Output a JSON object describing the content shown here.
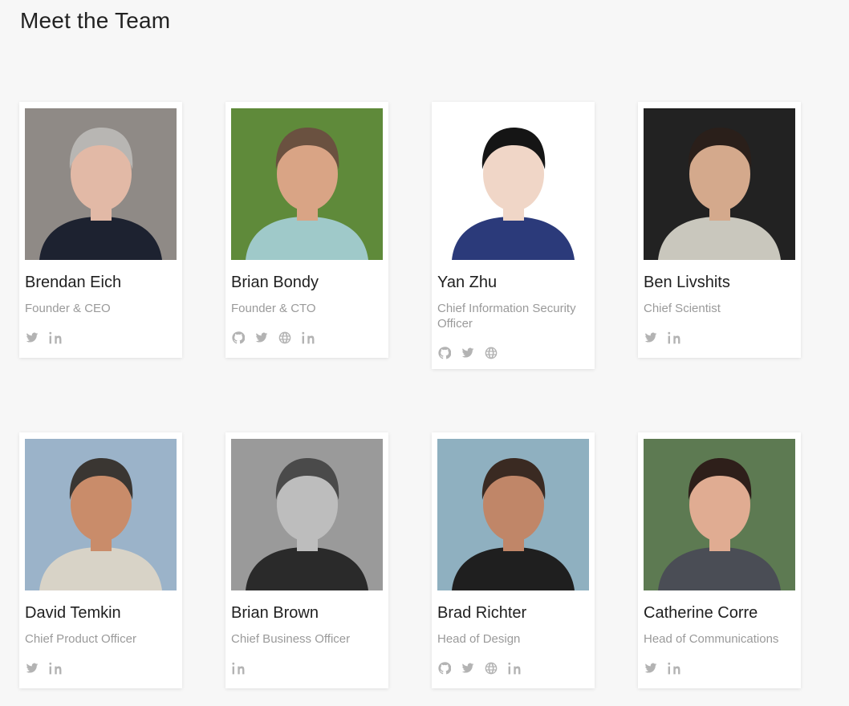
{
  "page": {
    "title": "Meet the Team"
  },
  "team": [
    {
      "name": "Brendan Eich",
      "role": "Founder & CEO",
      "socials": [
        "twitter-icon",
        "linkedin-icon"
      ],
      "photo_bg": "#8f8a86",
      "skin": "#e2b9a6",
      "hair": "#b8b6b3",
      "shirt": "#1d2230"
    },
    {
      "name": "Brian Bondy",
      "role": "Founder & CTO",
      "socials": [
        "github-icon",
        "twitter-icon",
        "website-icon",
        "linkedin-icon"
      ],
      "photo_bg": "#5f8a3a",
      "skin": "#d9a485",
      "hair": "#6a5140",
      "shirt": "#9fc9c9"
    },
    {
      "name": "Yan Zhu",
      "role": "Chief Information Security Officer",
      "socials": [
        "github-icon",
        "twitter-icon",
        "website-icon"
      ],
      "photo_bg": "#ffffff",
      "skin": "#f0d6c7",
      "hair": "#151515",
      "shirt": "#2b3a7a"
    },
    {
      "name": "Ben Livshits",
      "role": "Chief Scientist",
      "socials": [
        "twitter-icon",
        "linkedin-icon"
      ],
      "photo_bg": "#222222",
      "skin": "#d4a98c",
      "hair": "#2a1f1a",
      "shirt": "#c9c7bd"
    },
    {
      "name": "David Temkin",
      "role": "Chief Product Officer",
      "socials": [
        "twitter-icon",
        "linkedin-icon"
      ],
      "photo_bg": "#9bb3c9",
      "skin": "#c98c6a",
      "hair": "#3a3632",
      "shirt": "#d8d3c7"
    },
    {
      "name": "Brian Brown",
      "role": "Chief Business Officer",
      "socials": [
        "linkedin-icon"
      ],
      "photo_bg": "#9a9a9a",
      "skin": "#bdbdbd",
      "hair": "#4a4a4a",
      "shirt": "#2a2a2a"
    },
    {
      "name": "Brad Richter",
      "role": "Head of Design",
      "socials": [
        "github-icon",
        "twitter-icon",
        "website-icon",
        "linkedin-icon"
      ],
      "photo_bg": "#8fb0c0",
      "skin": "#c08668",
      "hair": "#3a2a22",
      "shirt": "#1f1f1f"
    },
    {
      "name": "Catherine Corre",
      "role": "Head of Communications",
      "socials": [
        "twitter-icon",
        "linkedin-icon"
      ],
      "photo_bg": "#5d7a52",
      "skin": "#e0ac92",
      "hair": "#2e1f1a",
      "shirt": "#4a4d55"
    }
  ],
  "colors": {
    "background": "#f7f7f7",
    "card": "#ffffff",
    "role_text": "#9a9a9a",
    "icon": "#b3b3b3"
  }
}
